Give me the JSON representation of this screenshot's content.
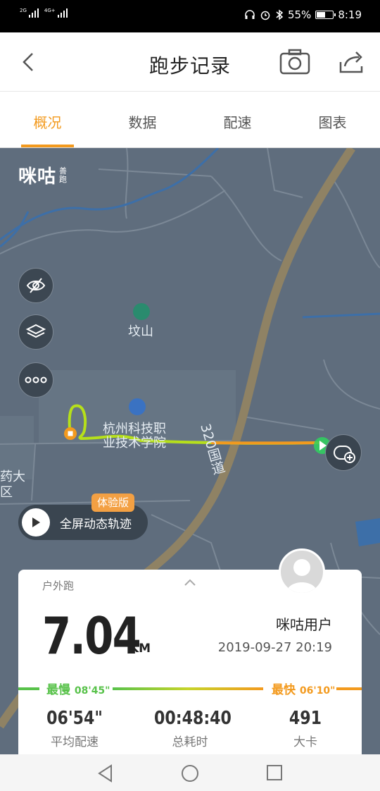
{
  "status_bar": {
    "signal1": "2G",
    "signal2": "4G+",
    "battery": "55%",
    "battery_level": 0.55,
    "time": "8:19"
  },
  "header": {
    "title": "跑步记录"
  },
  "tabs": [
    {
      "label": "概况",
      "active": true
    },
    {
      "label": "数据",
      "active": false
    },
    {
      "label": "配速",
      "active": false
    },
    {
      "label": "图表",
      "active": false
    }
  ],
  "map": {
    "logo_main": "咪咕",
    "logo_sub": "善跑",
    "poi_mountain": "坟山",
    "poi_school_line1": "杭州科技职",
    "poi_school_line2": "业技术学院",
    "road_label": "320国道",
    "edge_label_1": "药大",
    "edge_label_2": "区",
    "trial_badge": "体验版",
    "replay_label": "全屏动态轨迹"
  },
  "card": {
    "run_type": "户外跑",
    "distance": "7.04",
    "unit": "KM",
    "user": "咪咕用户",
    "date": "2019-09-27 20:19",
    "slowest_label": "最慢",
    "slowest_value": "08'45\"",
    "fastest_label": "最快",
    "fastest_value": "06'10\"",
    "stats": [
      {
        "value": "06'54\"",
        "label": "平均配速"
      },
      {
        "value": "00:48:40",
        "label": "总耗时"
      },
      {
        "value": "491",
        "label": "大卡"
      }
    ]
  },
  "colors": {
    "accent": "#f39a1e",
    "slow": "#58c24a",
    "map_bg": "#5f6d7d"
  }
}
